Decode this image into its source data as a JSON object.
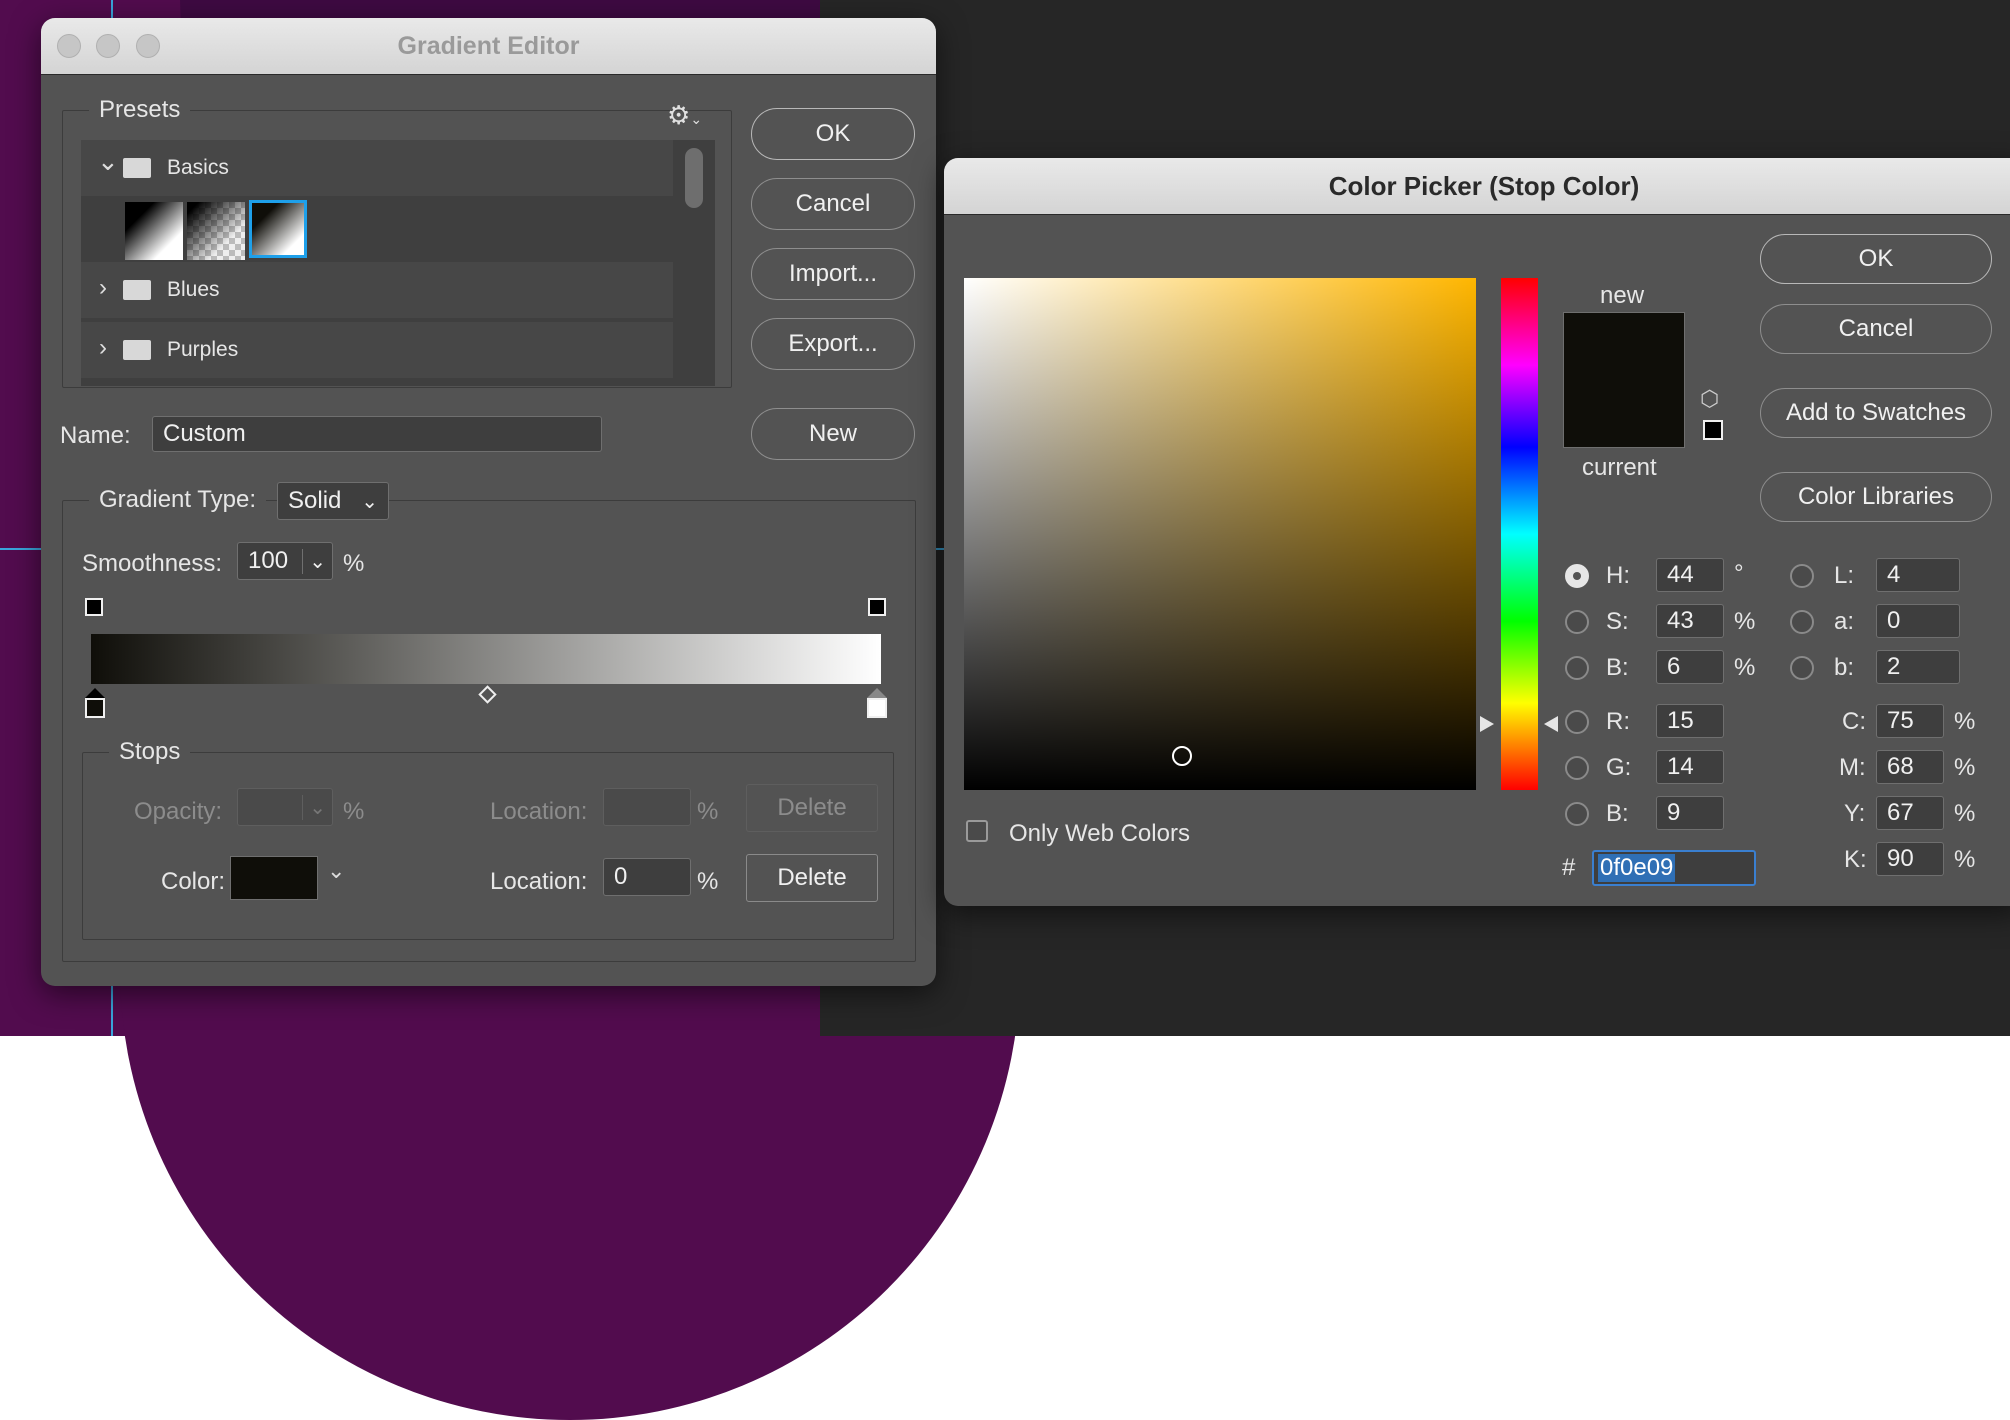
{
  "gradient_editor": {
    "title": "Gradient Editor",
    "buttons": {
      "ok": "OK",
      "cancel": "Cancel",
      "import": "Import...",
      "export": "Export...",
      "new": "New"
    },
    "presets": {
      "label": "Presets",
      "folders": [
        {
          "name": "Basics",
          "expanded": true
        },
        {
          "name": "Blues",
          "expanded": false
        },
        {
          "name": "Purples",
          "expanded": false
        }
      ]
    },
    "name_label": "Name:",
    "name_value": "Custom",
    "gradient_type_label": "Gradient Type:",
    "gradient_type_value": "Solid",
    "smoothness_label": "Smoothness:",
    "smoothness_value": "100",
    "percent": "%",
    "stops": {
      "label": "Stops",
      "opacity_label": "Opacity:",
      "opacity_value": "",
      "location_label": "Location:",
      "location_value_opacity": "",
      "delete_label": "Delete",
      "color_label": "Color:",
      "color_value": "#0f0e09",
      "location_value_color": "0"
    }
  },
  "color_picker": {
    "title": "Color Picker (Stop Color)",
    "buttons": {
      "ok": "OK",
      "cancel": "Cancel",
      "add_to_swatches": "Add to Swatches",
      "color_libraries": "Color Libraries"
    },
    "new_label": "new",
    "current_label": "current",
    "only_web_colors": "Only Web Colors",
    "hsb": [
      {
        "label": "H:",
        "value": "44",
        "unit": "°",
        "selected": true
      },
      {
        "label": "S:",
        "value": "43",
        "unit": "%",
        "selected": false
      },
      {
        "label": "B:",
        "value": "6",
        "unit": "%",
        "selected": false
      }
    ],
    "rgb": [
      {
        "label": "R:",
        "value": "15"
      },
      {
        "label": "G:",
        "value": "14"
      },
      {
        "label": "B:",
        "value": "9"
      }
    ],
    "lab": [
      {
        "label": "L:",
        "value": "4"
      },
      {
        "label": "a:",
        "value": "0"
      },
      {
        "label": "b:",
        "value": "2"
      }
    ],
    "cmyk": [
      {
        "label": "C:",
        "value": "75",
        "unit": "%"
      },
      {
        "label": "M:",
        "value": "68",
        "unit": "%"
      },
      {
        "label": "Y:",
        "value": "67",
        "unit": "%"
      },
      {
        "label": "K:",
        "value": "90",
        "unit": "%"
      }
    ],
    "hex_label": "#",
    "hex_value": "0f0e09",
    "colors": {
      "selected_color": "#0f0e09",
      "hue_color": "#ffb600",
      "accent": "#2f6fb5"
    }
  }
}
